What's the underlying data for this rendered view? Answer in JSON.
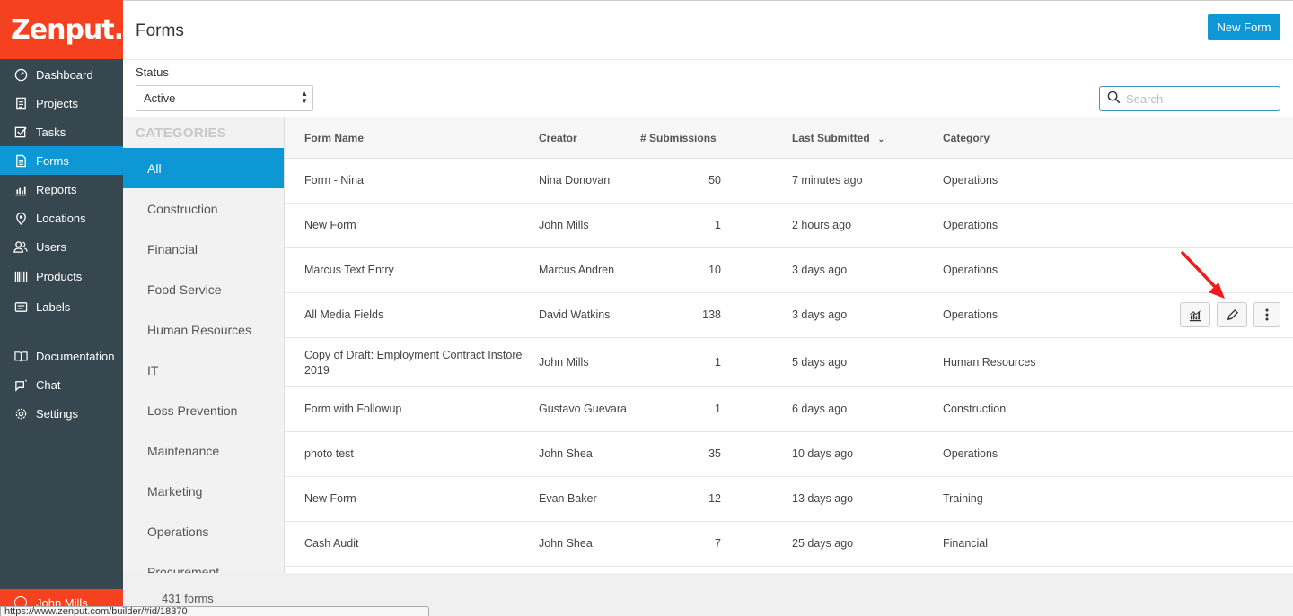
{
  "brand": {
    "logo_text": "Zenput.",
    "brand_color": "#f5411f",
    "accent_color": "#0d97d5",
    "sidebar_color": "#37474f"
  },
  "sidebar": {
    "items": [
      {
        "label": "Dashboard",
        "icon": "dashboard-gauge-icon"
      },
      {
        "label": "Projects",
        "icon": "projects-icon"
      },
      {
        "label": "Tasks",
        "icon": "checkbox-icon"
      },
      {
        "label": "Forms",
        "icon": "document-icon",
        "active": true
      },
      {
        "label": "Reports",
        "icon": "bar-chart-icon"
      },
      {
        "label": "Locations",
        "icon": "map-pin-icon"
      },
      {
        "label": "Users",
        "icon": "users-icon"
      },
      {
        "label": "Products",
        "icon": "barcode-icon"
      },
      {
        "label": "Labels",
        "icon": "label-icon"
      }
    ],
    "secondary": [
      {
        "label": "Documentation",
        "icon": "book-icon"
      },
      {
        "label": "Chat",
        "icon": "chat-icon"
      },
      {
        "label": "Settings",
        "icon": "gear-icon"
      }
    ],
    "user": "John Mills"
  },
  "header": {
    "title": "Forms",
    "new_form_label": "New Form"
  },
  "filters": {
    "status_label": "Status",
    "status_value": "Active",
    "search_placeholder": "Search"
  },
  "categories": {
    "header": "CATEGORIES",
    "items": [
      "All",
      "Construction",
      "Financial",
      "Food Service",
      "Human Resources",
      "IT",
      "Loss Prevention",
      "Maintenance",
      "Marketing",
      "Operations",
      "Procurement"
    ],
    "active": "All"
  },
  "table": {
    "columns": {
      "name": "Form Name",
      "creator": "Creator",
      "submissions": "# Submissions",
      "last": "Last Submitted",
      "category": "Category"
    },
    "sort_column": "Last Submitted",
    "rows": [
      {
        "name": "Form - Nina",
        "creator": "Nina Donovan",
        "submissions": "50",
        "last": "7 minutes ago",
        "category": "Operations"
      },
      {
        "name": "New Form",
        "creator": "John Mills",
        "submissions": "1",
        "last": "2 hours ago",
        "category": "Operations"
      },
      {
        "name": "Marcus Text Entry",
        "creator": "Marcus Andren",
        "submissions": "10",
        "last": "3 days ago",
        "category": "Operations"
      },
      {
        "name": "All Media Fields",
        "creator": "David Watkins",
        "submissions": "138",
        "last": "3 days ago",
        "category": "Operations"
      },
      {
        "name": "Copy of Draft: Employment Contract Instore",
        "name_line2": "2019",
        "creator": "John Mills",
        "submissions": "1",
        "last": "5 days ago",
        "category": "Human Resources"
      },
      {
        "name": "Form with Followup",
        "creator": "Gustavo Guevara",
        "submissions": "1",
        "last": "6 days ago",
        "category": "Construction"
      },
      {
        "name": "photo test",
        "creator": "John Shea",
        "submissions": "35",
        "last": "10 days ago",
        "category": "Operations"
      },
      {
        "name": "New Form",
        "creator": "Evan Baker",
        "submissions": "12",
        "last": "13 days ago",
        "category": "Training"
      },
      {
        "name": "Cash Audit",
        "creator": "John Shea",
        "submissions": "7",
        "last": "25 days ago",
        "category": "Financial"
      }
    ]
  },
  "footer": {
    "count": "431 forms",
    "url": "https://www.zenput.com/builder/#id/18370"
  }
}
